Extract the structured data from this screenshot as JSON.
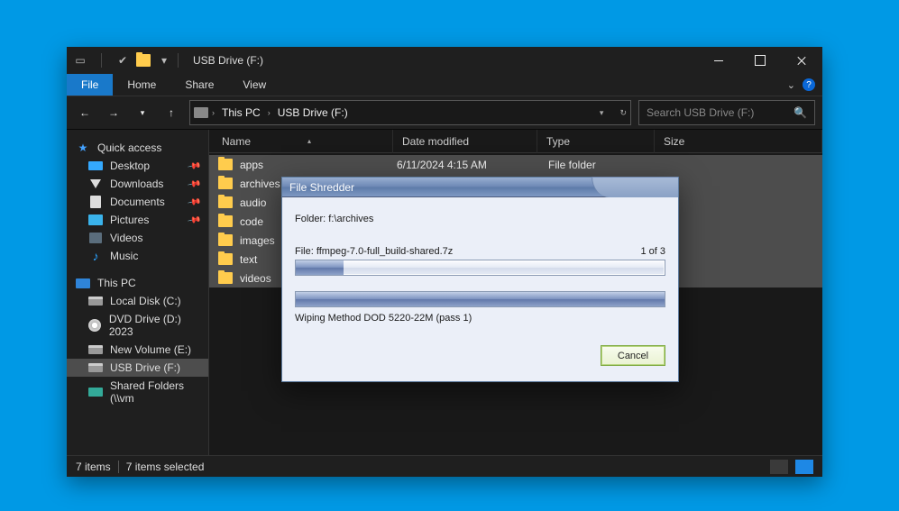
{
  "titlebar": {
    "title": "USB Drive (F:)"
  },
  "ribbon": {
    "file": "File",
    "home": "Home",
    "share": "Share",
    "view": "View"
  },
  "nav": {
    "crumb1": "This PC",
    "crumb2": "USB Drive (F:)"
  },
  "search": {
    "placeholder": "Search USB Drive (F:)"
  },
  "sidebar": {
    "quick_access": "Quick access",
    "items_quick": [
      "Desktop",
      "Downloads",
      "Documents",
      "Pictures",
      "Videos",
      "Music"
    ],
    "this_pc": "This PC",
    "items_pc": [
      "Local Disk (C:)",
      "DVD Drive (D:) 2023",
      "New Volume (E:)",
      "USB Drive (F:)",
      "Shared Folders (\\\\vm"
    ]
  },
  "columns": {
    "name": "Name",
    "date": "Date modified",
    "type": "Type",
    "size": "Size"
  },
  "rows": [
    {
      "name": "apps",
      "date": "6/11/2024 4:15 AM",
      "type": "File folder"
    },
    {
      "name": "archives",
      "date": "",
      "type": ""
    },
    {
      "name": "audio",
      "date": "",
      "type": ""
    },
    {
      "name": "code",
      "date": "",
      "type": ""
    },
    {
      "name": "images",
      "date": "",
      "type": ""
    },
    {
      "name": "text",
      "date": "",
      "type": ""
    },
    {
      "name": "videos",
      "date": "",
      "type": ""
    }
  ],
  "status": {
    "items": "7 items",
    "selected": "7 items selected"
  },
  "dialog": {
    "title": "File Shredder",
    "folder_label": "Folder: f:\\archives",
    "file_label": "File: ffmpeg-7.0-full_build-shared.7z",
    "count": "1  of  3",
    "file_progress_pct": 13,
    "overall_progress_pct": 100,
    "method": "Wiping Method DOD 5220-22M  (pass 1)",
    "cancel": "Cancel"
  }
}
